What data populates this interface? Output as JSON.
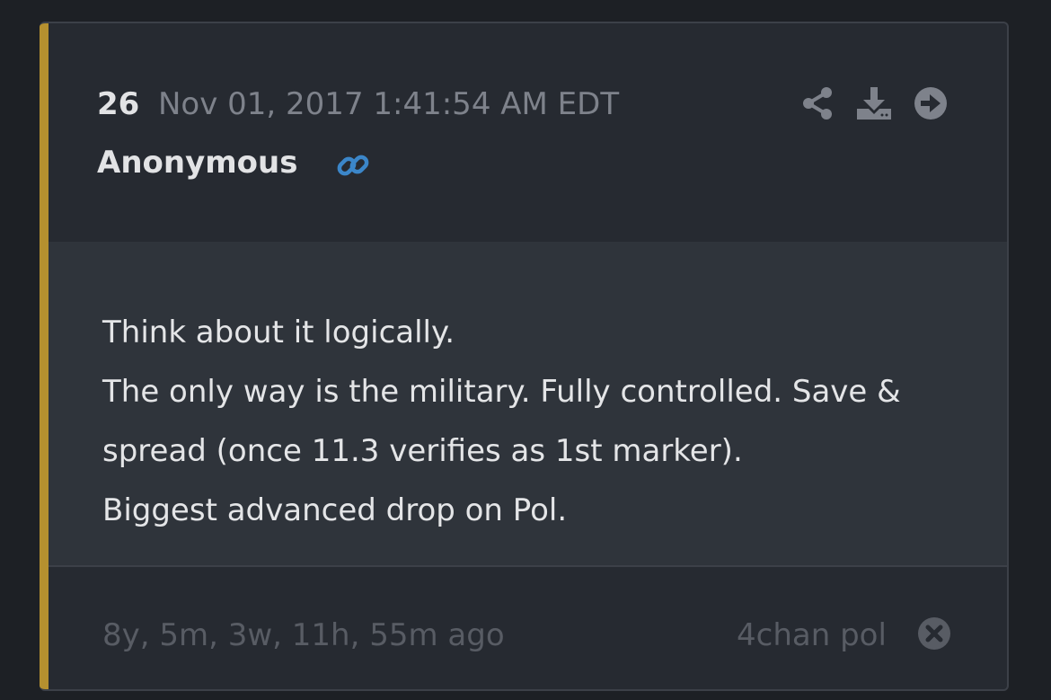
{
  "post": {
    "number": "26",
    "date": "Nov 01, 2017 1:41:54 AM EDT",
    "author": "Anonymous",
    "body_lines": [
      "Think about it logically.",
      "The only way is the military. Fully controlled. Save &",
      "spread (once 11.3 verifies as 1st marker).",
      "Biggest advanced drop on Pol."
    ],
    "time_ago": "8y, 5m, 3w, 11h, 55m ago",
    "source": "4chan pol"
  },
  "icons": {
    "link": "link-icon",
    "share": "share-icon",
    "download": "download-icon",
    "goto": "arrow-circle-right-icon",
    "close": "close-circle-icon"
  },
  "colors": {
    "accent": "#b5902f",
    "link": "#3b86c9",
    "page_background": "#1d2025",
    "card_background": "#262a31",
    "body_background": "#2f343b"
  }
}
